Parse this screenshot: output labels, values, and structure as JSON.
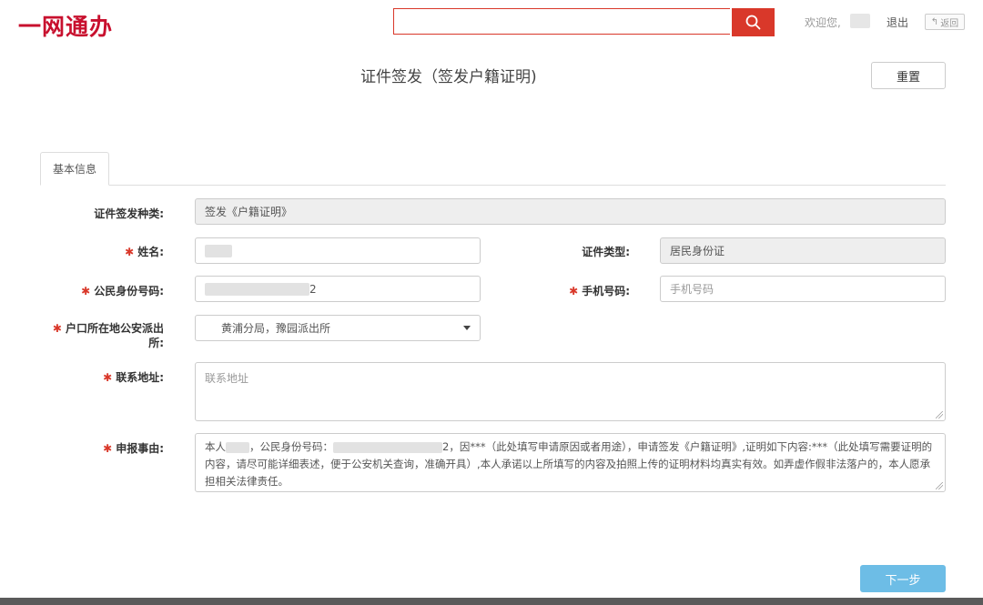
{
  "header": {
    "logo": "一网通办",
    "search_value": "",
    "welcome": "欢迎您,",
    "logout": "退出",
    "back": "返回"
  },
  "page": {
    "title": "证件签发（签发户籍证明)",
    "reset": "重置"
  },
  "tabs": [
    {
      "label": "基本信息"
    }
  ],
  "form": {
    "cert_type_issue": {
      "label": "证件签发种类:",
      "value": "签发《户籍证明》"
    },
    "name": {
      "label": "姓名:",
      "value": ""
    },
    "cert_type": {
      "label": "证件类型:",
      "value": "居民身份证"
    },
    "id_number": {
      "label": "公民身份号码:",
      "value_suffix": "2"
    },
    "phone": {
      "label": "手机号码:",
      "placeholder": "手机号码"
    },
    "police_station": {
      "label_line1": "户口所在地公安派出",
      "label_line2": "所:",
      "value": "黄浦分局，豫园派出所"
    },
    "address": {
      "label": "联系地址:",
      "placeholder": "联系地址"
    },
    "reason": {
      "label": "申报事由:",
      "seg1": "本人",
      "seg2": "，公民身份号码：",
      "seg3": "2，因***（此处填写申请原因或者用途），申请签发《户籍证明》,证明如下内容:***（此处填写需要证明的内容，请尽可能详细表述，便于公安机关查询，准确开具）,本人承诺以上所填写的内容及拍照上传的证明材料均真实有效。如弄虚作假非法落户的，本人愿承担相关法律责任。"
    }
  },
  "footer": {
    "next": "下一步"
  },
  "colors": {
    "brand": "#c8102e",
    "search": "#d9382a",
    "next": "#6dbde6"
  }
}
